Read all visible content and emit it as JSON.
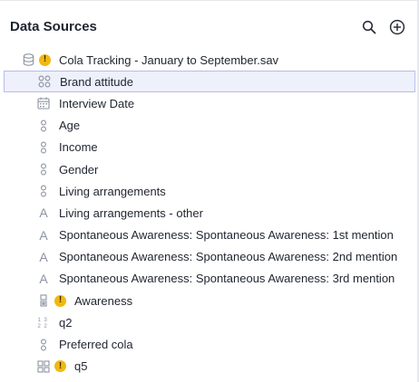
{
  "panel": {
    "title": "Data Sources"
  },
  "header_icons": [
    "search-icon",
    "add-circle-icon"
  ],
  "tree": {
    "root": {
      "label": "Cola Tracking - January to September.sav",
      "icon": "database-icon",
      "warning": "!"
    },
    "items": [
      {
        "label": "Brand attitude",
        "icon": "grid-circles-icon",
        "selected": true
      },
      {
        "label": "Interview Date",
        "icon": "calendar-icon"
      },
      {
        "label": "Age",
        "icon": "nominal-icon"
      },
      {
        "label": "Income",
        "icon": "nominal-icon"
      },
      {
        "label": "Gender",
        "icon": "nominal-icon"
      },
      {
        "label": "Living arrangements",
        "icon": "nominal-icon"
      },
      {
        "label": "Living arrangements - other",
        "icon": "text-icon",
        "glyph": "A"
      },
      {
        "label": "Spontaneous Awareness: Spontaneous Awareness: 1st mention",
        "icon": "text-icon",
        "glyph": "A"
      },
      {
        "label": "Spontaneous Awareness: Spontaneous Awareness: 2nd mention",
        "icon": "text-icon",
        "glyph": "A"
      },
      {
        "label": "Spontaneous Awareness: Spontaneous Awareness: 3rd mention",
        "icon": "text-icon",
        "glyph": "A"
      },
      {
        "label": "Awareness",
        "icon": "multi-binary-icon",
        "warning": "!"
      },
      {
        "label": "q2",
        "icon": "numeric-grid-icon"
      },
      {
        "label": "Preferred cola",
        "icon": "nominal-icon"
      },
      {
        "label": "q5",
        "icon": "grid-squares-icon",
        "warning": "!"
      }
    ]
  },
  "colors": {
    "accent_border": "#b7bde8",
    "selected_bg": "#eef0fb",
    "warning": "#f2b80f",
    "icon_gray": "#8c93a0"
  }
}
